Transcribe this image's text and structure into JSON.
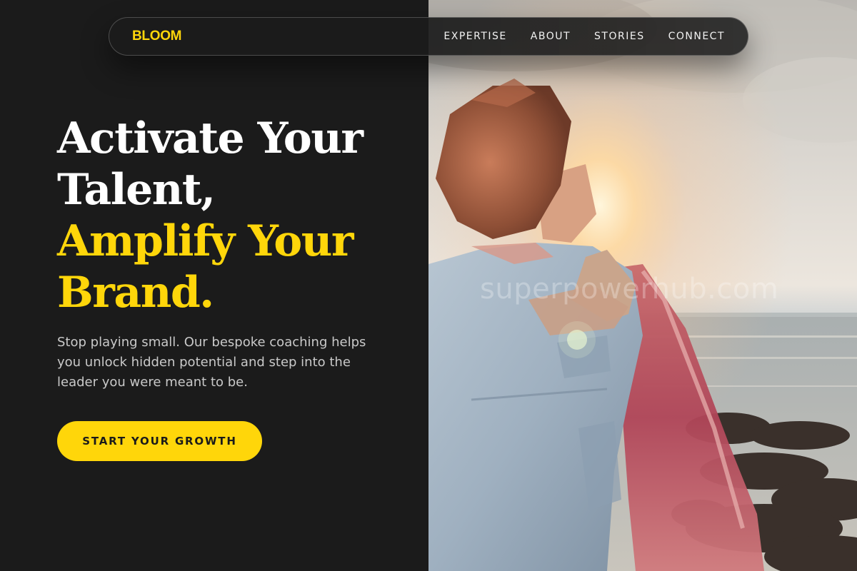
{
  "brand": {
    "logo": "BLOOM",
    "accent_color": "#ffd60a",
    "background_color": "#1b1b1b"
  },
  "nav": {
    "items": [
      {
        "label": "EXPERTISE"
      },
      {
        "label": "ABOUT"
      },
      {
        "label": "STORIES"
      },
      {
        "label": "CONNECT"
      }
    ]
  },
  "hero": {
    "headline_lines": [
      "Activate Your",
      "Talent,",
      "Amplify Your",
      "Brand."
    ],
    "subtext": "Stop playing small. Our bespoke coaching helps you unlock hidden potential and step into the leader you were meant to be.",
    "cta_label": "START YOUR GROWTH"
  },
  "watermark": "superpowerhub.com"
}
